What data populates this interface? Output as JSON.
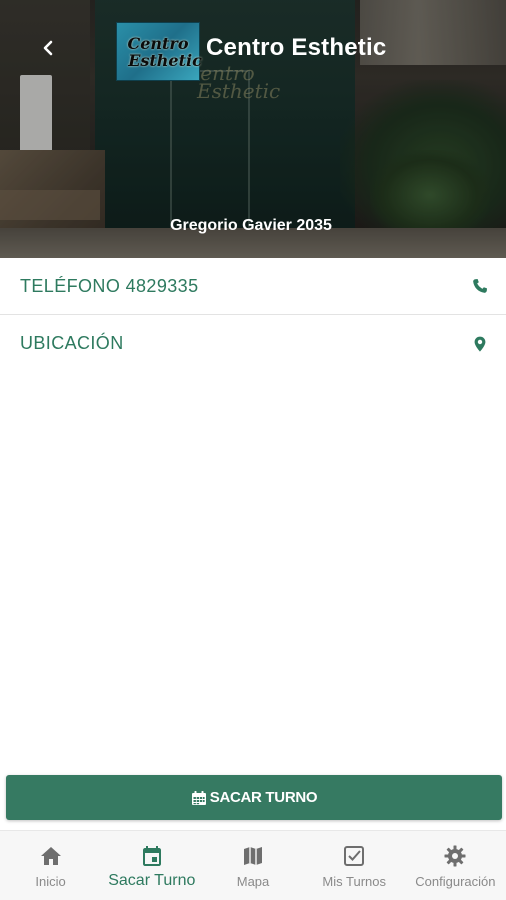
{
  "header": {
    "title": "Centro Esthetic",
    "address": "Gregorio Gavier 2035",
    "logo_text": [
      "Centro",
      "Esthetic"
    ]
  },
  "rows": {
    "phone_label": "TELÉFONO 4829335",
    "location_label": "UBICACIÓN"
  },
  "action": {
    "label": "SACAR TURNO",
    "icon": "calendar-icon"
  },
  "nav": {
    "items": [
      {
        "label": "Inicio",
        "icon": "home-icon",
        "active": false
      },
      {
        "label": "Sacar Turno",
        "icon": "calendar-icon",
        "active": true
      },
      {
        "label": "Mapa",
        "icon": "map-icon",
        "active": false
      },
      {
        "label": "Mis Turnos",
        "icon": "checkbox-icon",
        "active": false
      },
      {
        "label": "Configuración",
        "icon": "gear-icon",
        "active": false
      }
    ]
  },
  "colors": {
    "accent": "#2e7a5f",
    "button": "#367a62",
    "nav_inactive": "#8a8a8a"
  }
}
